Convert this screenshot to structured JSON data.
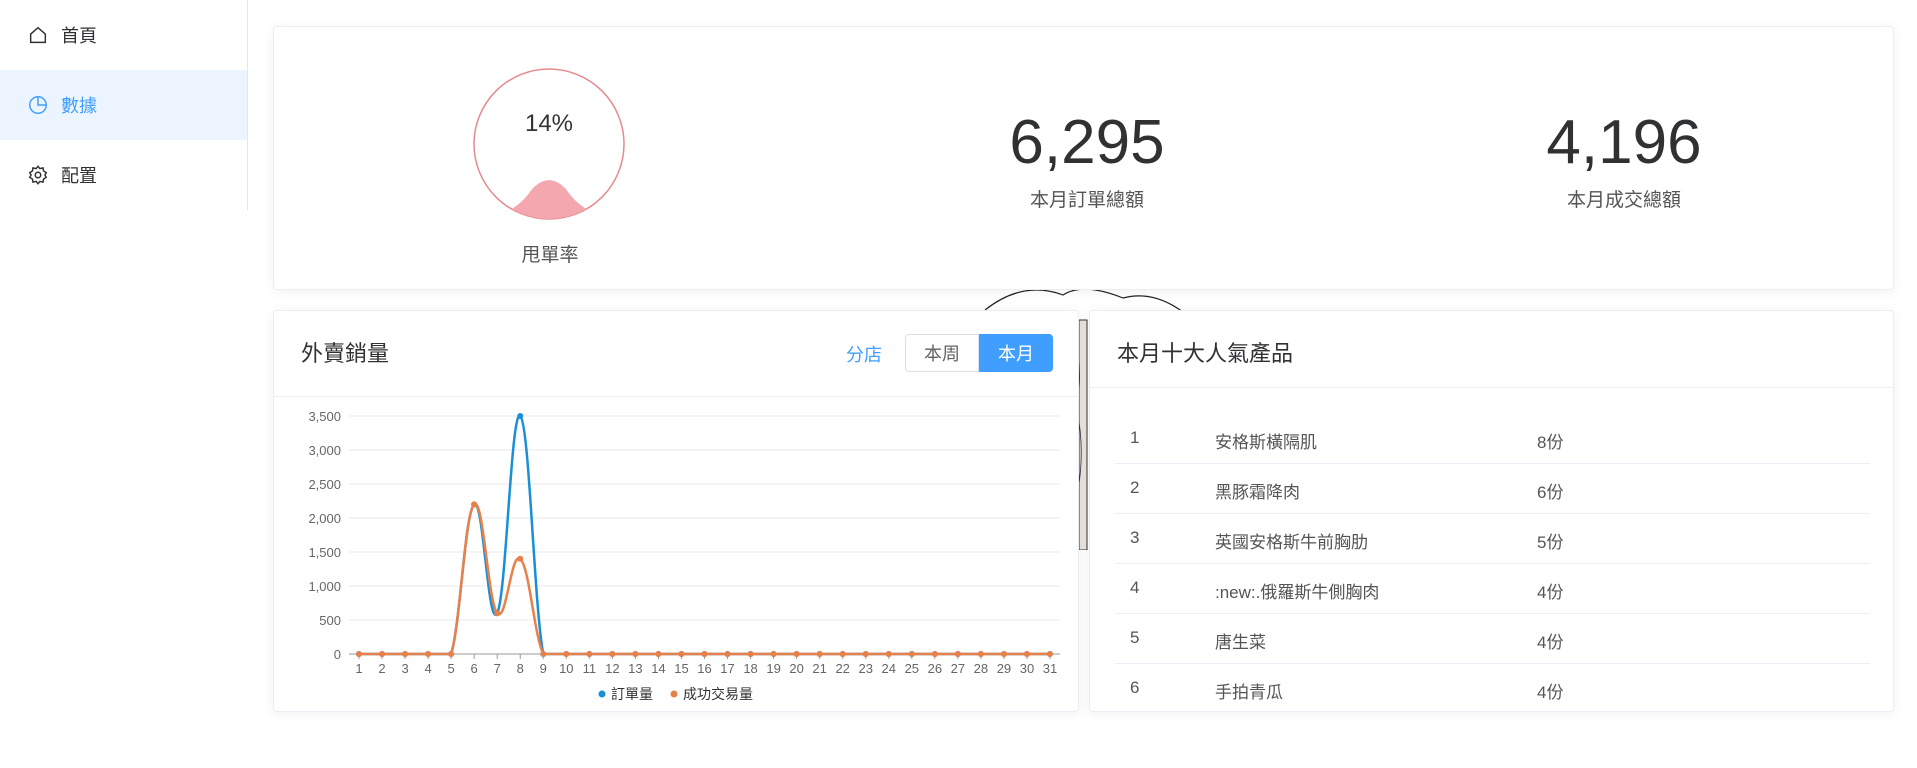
{
  "sidebar": {
    "items": [
      {
        "label": "首頁",
        "icon": "home-icon"
      },
      {
        "label": "數據",
        "icon": "pie-chart-icon"
      },
      {
        "label": "配置",
        "icon": "gear-icon"
      }
    ]
  },
  "stats": {
    "dump_rate": {
      "value": "14%",
      "fraction": 0.14,
      "label": "甩單率"
    },
    "orders_total": {
      "value": "6,295",
      "label": "本月訂單總額"
    },
    "deals_total": {
      "value": "4,196",
      "label": "本月成交總額"
    }
  },
  "sales": {
    "title": "外賣銷量",
    "branch_link": "分店",
    "toggle_week": "本周",
    "toggle_month": "本月"
  },
  "top_products": {
    "title": "本月十大人氣產品",
    "rows": [
      {
        "rank": "1",
        "name": "安格斯橫隔肌",
        "qty": "8份"
      },
      {
        "rank": "2",
        "name": "黑豚霜降肉",
        "qty": "6份"
      },
      {
        "rank": "3",
        "name": "英國安格斯牛前胸肋",
        "qty": "5份"
      },
      {
        "rank": "4",
        "name": ":new:.俄羅斯牛側胸肉",
        "qty": "4份"
      },
      {
        "rank": "5",
        "name": "唐生菜",
        "qty": "4份"
      },
      {
        "rank": "6",
        "name": "手拍青瓜",
        "qty": "4份"
      }
    ]
  },
  "colors": {
    "accent": "#409eff",
    "order_series": "#1a8fd6",
    "deal_series": "#e8804a",
    "gauge_fill": "#f4a7ae",
    "gauge_border": "#e58a8f"
  },
  "chart_data": {
    "type": "line",
    "x": [
      1,
      2,
      3,
      4,
      5,
      6,
      7,
      8,
      9,
      10,
      11,
      12,
      13,
      14,
      15,
      16,
      17,
      18,
      19,
      20,
      21,
      22,
      23,
      24,
      25,
      26,
      27,
      28,
      29,
      30,
      31
    ],
    "ylim": [
      0,
      3500
    ],
    "yticks": [
      "0",
      "500",
      "1,000",
      "1,500",
      "2,000",
      "2,500",
      "3,000",
      "3,500"
    ],
    "grid": true,
    "legend": "bottom",
    "series": [
      {
        "name": "訂單量",
        "values": [
          0,
          0,
          0,
          0,
          0,
          2200,
          600,
          3500,
          0,
          0,
          0,
          0,
          0,
          0,
          0,
          0,
          0,
          0,
          0,
          0,
          0,
          0,
          0,
          0,
          0,
          0,
          0,
          0,
          0,
          0,
          0
        ]
      },
      {
        "name": "成功交易量",
        "values": [
          0,
          0,
          0,
          0,
          0,
          2200,
          600,
          1400,
          0,
          0,
          0,
          0,
          0,
          0,
          0,
          0,
          0,
          0,
          0,
          0,
          0,
          0,
          0,
          0,
          0,
          0,
          0,
          0,
          0,
          0,
          0
        ]
      }
    ]
  }
}
